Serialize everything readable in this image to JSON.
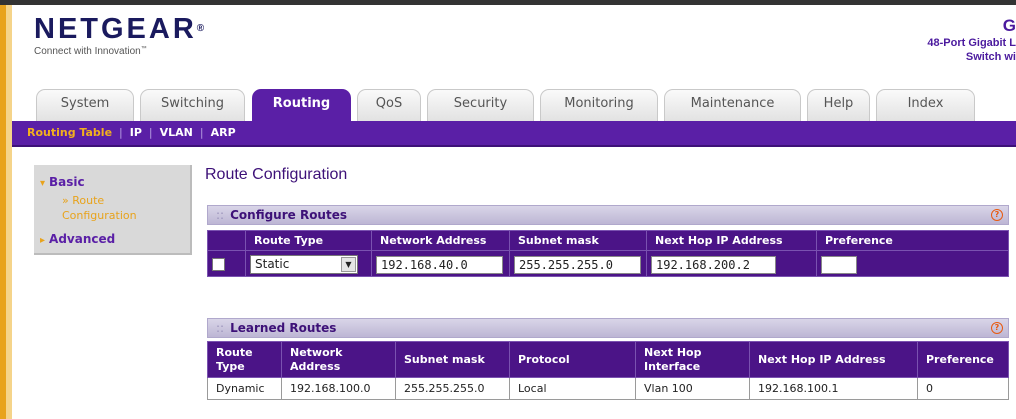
{
  "brand": {
    "logo": "NETGEAR",
    "logo_mark": "®",
    "tagline": "Connect with Innovation",
    "tagline_mark": "™",
    "product_line0": "G",
    "product_line1": "48-Port Gigabit L",
    "product_line2": "Switch wi"
  },
  "tabs": [
    {
      "label": "System"
    },
    {
      "label": "Switching"
    },
    {
      "label": "Routing"
    },
    {
      "label": "QoS"
    },
    {
      "label": "Security"
    },
    {
      "label": "Monitoring"
    },
    {
      "label": "Maintenance"
    },
    {
      "label": "Help"
    },
    {
      "label": "Index"
    }
  ],
  "subnav": [
    "Routing Table",
    "IP",
    "VLAN",
    "ARP"
  ],
  "sidebar": {
    "basic": "Basic",
    "route_config": "» Route Configuration",
    "advanced": "Advanced"
  },
  "page_title": "Route Configuration",
  "configure_routes": {
    "title": "Configure Routes",
    "headers": [
      "Route Type",
      "Network Address",
      "Subnet mask",
      "Next Hop IP Address",
      "Preference"
    ],
    "route_type": "Static",
    "network_address": "192.168.40.0",
    "subnet_mask": "255.255.255.0",
    "next_hop": "192.168.200.2",
    "preference": ""
  },
  "learned_routes": {
    "title": "Learned Routes",
    "headers": [
      "Route Type",
      "Network Address",
      "Subnet mask",
      "Protocol",
      "Next Hop Interface",
      "Next Hop IP Address",
      "Preference"
    ],
    "rows": [
      [
        "Dynamic",
        "192.168.100.0",
        "255.255.255.0",
        "Local",
        "Vlan 100",
        "192.168.100.1",
        "0"
      ]
    ]
  },
  "colors": {
    "accent_purple": "#5a1fa6",
    "header_purple": "#4b1487",
    "accent_orange": "#e8a31c"
  }
}
